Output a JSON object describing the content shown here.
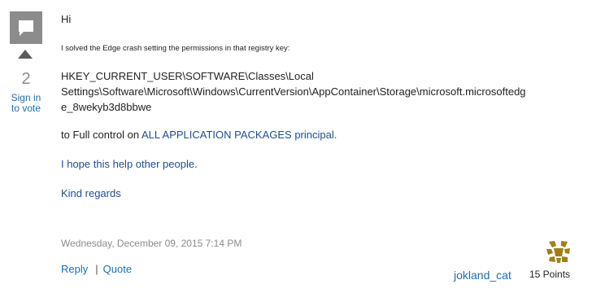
{
  "votes": {
    "count": "2",
    "sign_in_line1": "Sign in",
    "sign_in_line2": "to vote"
  },
  "post": {
    "greeting": "Hi",
    "intro": "I solved the Edge crash  setting the permissions in that registry key:",
    "registry_key_line1": "HKEY_CURRENT_USER\\SOFTWARE\\Classes\\Local",
    "registry_key_line2": "Settings\\Software\\Microsoft\\Windows\\CurrentVersion\\AppContainer\\Storage\\microsoft.microsoftedg",
    "registry_key_line3": "e_8wekyb3d8bbwe",
    "full_control_prefix": "to Full control on ",
    "full_control_target": "ALL APPLICATION PACKAGES  principal.",
    "hope": "I hope this help other people.",
    "regards": "Kind regards",
    "timestamp": "Wednesday, December 09, 2015 7:14 PM"
  },
  "actions": {
    "reply": "Reply",
    "separator": "|",
    "quote": "Quote"
  },
  "author": {
    "name": "jokland_cat",
    "points": "15 Points",
    "avatar_icon": "gold-medal-icon"
  },
  "colors": {
    "link": "#1a6fb3",
    "accent_text": "#1f4e8a",
    "muted": "#8c8c8c",
    "badge": "#8c8c8c",
    "avatar": "#a07f1a"
  }
}
